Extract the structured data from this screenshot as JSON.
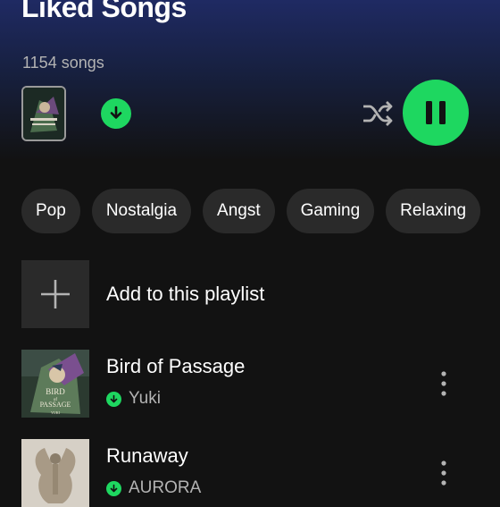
{
  "header": {
    "title": "Liked Songs",
    "song_count": "1154 songs"
  },
  "controls": {
    "download_icon": "download-arrow-icon",
    "shuffle_icon": "shuffle-icon",
    "play_state_icon": "pause-icon",
    "accent_color": "#1ed760"
  },
  "filters": [
    {
      "label": "Pop"
    },
    {
      "label": "Nostalgia"
    },
    {
      "label": "Angst"
    },
    {
      "label": "Gaming"
    },
    {
      "label": "Relaxing"
    }
  ],
  "add_row": {
    "label": "Add to this playlist",
    "icon": "plus-icon"
  },
  "tracks": [
    {
      "title": "Bird of Passage",
      "artist": "Yuki",
      "downloaded": true,
      "cover_text": [
        "BIRD",
        "of",
        "PASSAGE",
        "YUKI"
      ]
    },
    {
      "title": "Runaway",
      "artist": "AURORA",
      "downloaded": true
    }
  ]
}
